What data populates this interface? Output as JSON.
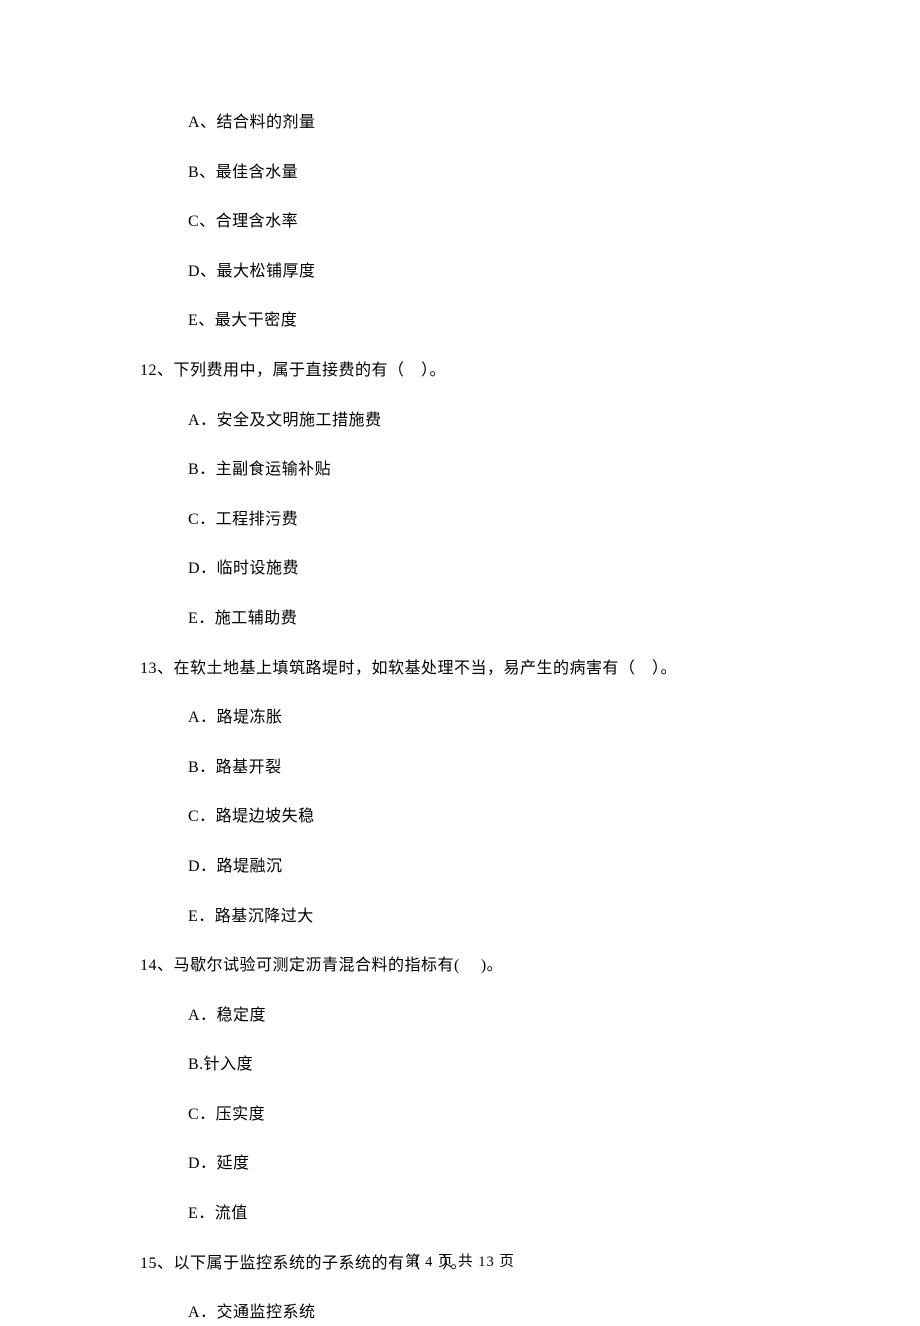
{
  "opts_pre": [
    "A、结合料的剂量",
    "B、最佳含水量",
    "C、合理含水率",
    "D、最大松铺厚度",
    "E、最大干密度"
  ],
  "q12": {
    "text": "12、下列费用中，属于直接费的有（　）。",
    "opts": [
      "A．安全及文明施工措施费",
      "B．主副食运输补贴",
      "C．工程排污费",
      "D．临时设施费",
      "E．施工辅助费"
    ]
  },
  "q13": {
    "text": "13、在软土地基上填筑路堤时，如软基处理不当，易产生的病害有（　）。",
    "opts": [
      "A．路堤冻胀",
      "B．路基开裂",
      "C．路堤边坡失稳",
      "D．路堤融沉",
      "E．路基沉降过大"
    ]
  },
  "q14": {
    "text": "14、马歇尔试验可测定沥青混合料的指标有(　 )。",
    "opts": [
      "A．稳定度",
      "B.针入度",
      "C．压实度",
      "D．延度",
      "E．流值"
    ]
  },
  "q15": {
    "text": "15、以下属于监控系统的子系统的有（　 ）。",
    "opts": [
      "A．交通监控系统"
    ]
  },
  "footer": "第 4 页 共 13 页"
}
